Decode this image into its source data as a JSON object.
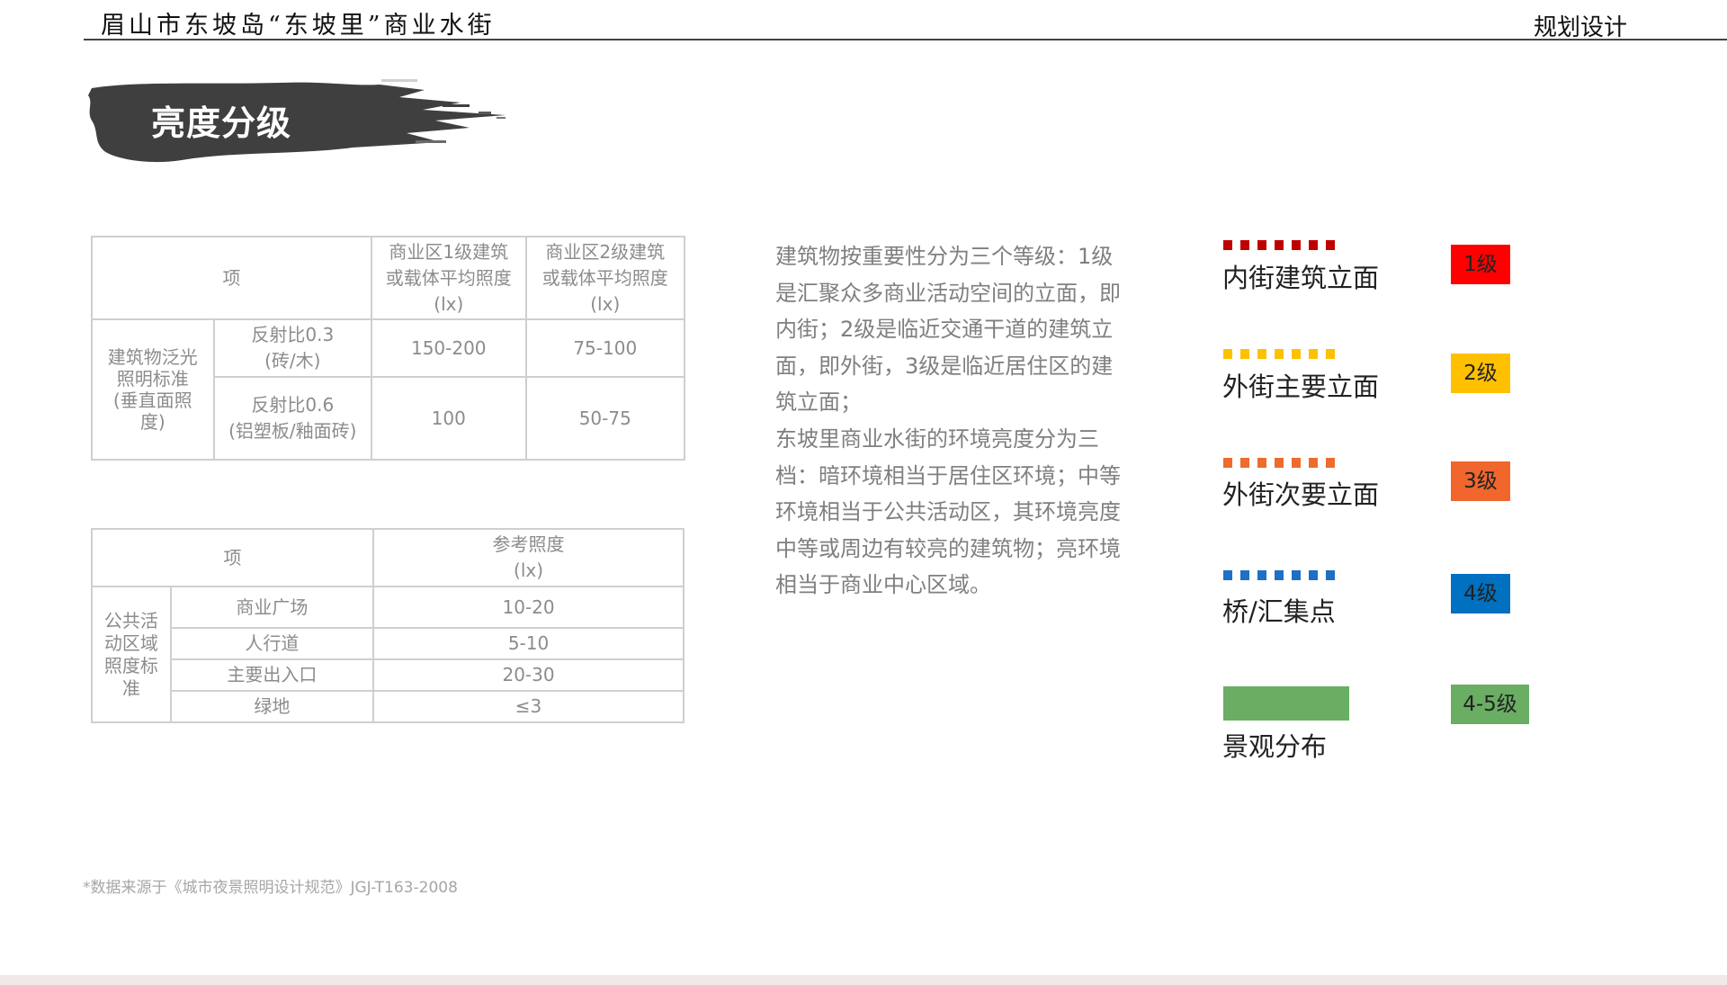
{
  "header": {
    "project": "眉山市东坡岛“东坡里”商业水街",
    "section": "规划设计"
  },
  "title": "亮度分级",
  "table1": {
    "head_item": "项",
    "head_col1": [
      "商业区1级建筑",
      "或载体平均照度",
      "(lx)"
    ],
    "head_col2": [
      "商业区2级建筑",
      "或载体平均照度",
      "(lx)"
    ],
    "group_label": [
      "建筑物泛光",
      "照明标准",
      "(垂直面照",
      "度)"
    ],
    "rows": [
      {
        "label": [
          "反射比0.3",
          "(砖/木)"
        ],
        "v1": "150-200",
        "v2": "75-100"
      },
      {
        "label": [
          "反射比0.6",
          "(铝塑板/釉面砖)"
        ],
        "v1": "100",
        "v2": "50-75"
      }
    ]
  },
  "table2": {
    "head_item": "项",
    "head_col": [
      "参考照度",
      "(lx)"
    ],
    "group_label": [
      "公共活",
      "动区域",
      "照度标",
      "准"
    ],
    "rows": [
      {
        "label": "商业广场",
        "value": "10-20"
      },
      {
        "label": "人行道",
        "value": "5-10"
      },
      {
        "label": "主要出入口",
        "value": "20-30"
      },
      {
        "label": "绿地",
        "value": "≤3"
      }
    ]
  },
  "description": [
    "建筑物按重要性分为三个等级：1级是汇聚众多商业活动空间的立面，即内街；2级是临近交通干道的建筑立面，即外街，3级是临近居住区的建筑立面；",
    "东坡里商业水街的环境亮度分为三档：暗环境相当于居住区环境；中等环境相当于公共活动区，其环境亮度中等或周边有较亮的建筑物；亮环境相当于商业中心区域。"
  ],
  "legend": [
    {
      "label": "内街建筑立面",
      "badge": "1级",
      "line_color": "#c00000",
      "badge_color": "#ff0000",
      "style": "dotted"
    },
    {
      "label": "外街主要立面",
      "badge": "2级",
      "line_color": "#ffc000",
      "badge_color": "#ffc000",
      "style": "dotted"
    },
    {
      "label": "外街次要立面",
      "badge": "3级",
      "line_color": "#ed6b2f",
      "badge_color": "#f0662d",
      "style": "dotted"
    },
    {
      "label": "桥/汇集点",
      "badge": "4级",
      "line_color": "#1f6fc4",
      "badge_color": "#0070c0",
      "style": "dotted"
    },
    {
      "label": "景观分布",
      "badge": "4-5级",
      "line_color": "#6aae64",
      "badge_color": "#6aae64",
      "style": "solid"
    }
  ],
  "footnote": "*数据来源于《城市夜景照明设计规范》JGJ-T163-2008"
}
